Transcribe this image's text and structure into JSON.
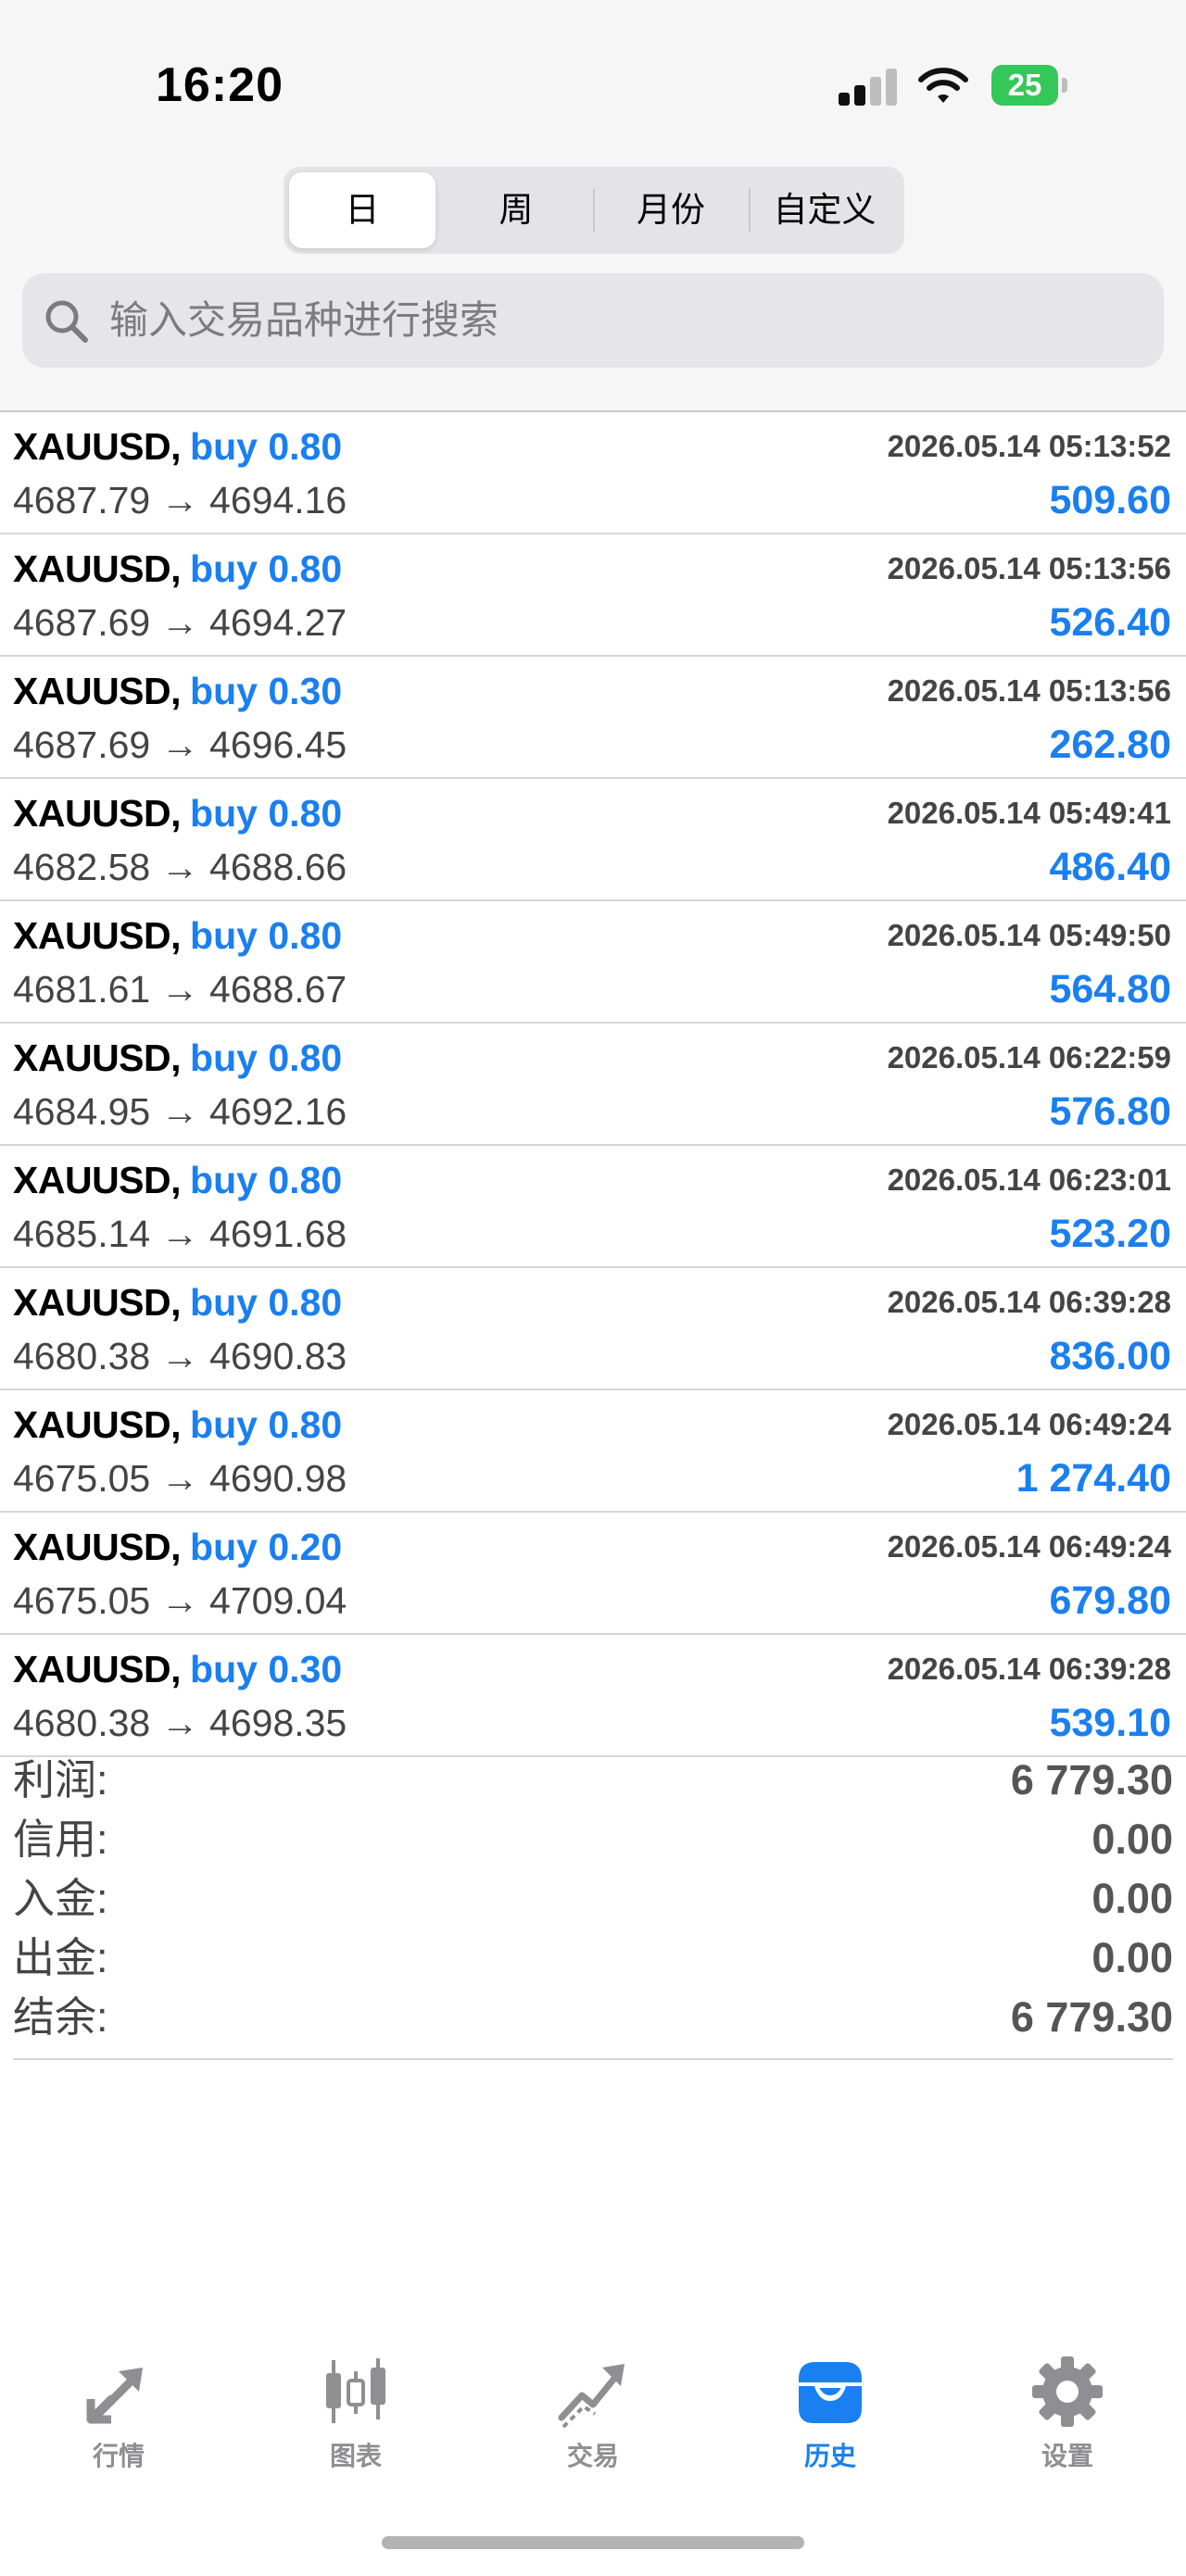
{
  "status_bar": {
    "time": "16:20",
    "battery": "25"
  },
  "segments": {
    "day": "日",
    "week": "周",
    "month": "月份",
    "custom": "自定义",
    "selected": "日"
  },
  "search": {
    "placeholder": "输入交易品种进行搜索"
  },
  "trades": [
    {
      "symbol": "XAUUSD,",
      "side": "buy",
      "volume": "0.80",
      "time": "2026.05.14 05:13:52",
      "open": "4687.79",
      "close": "4694.16",
      "profit": "509.60"
    },
    {
      "symbol": "XAUUSD,",
      "side": "buy",
      "volume": "0.80",
      "time": "2026.05.14 05:13:56",
      "open": "4687.69",
      "close": "4694.27",
      "profit": "526.40"
    },
    {
      "symbol": "XAUUSD,",
      "side": "buy",
      "volume": "0.30",
      "time": "2026.05.14 05:13:56",
      "open": "4687.69",
      "close": "4696.45",
      "profit": "262.80"
    },
    {
      "symbol": "XAUUSD,",
      "side": "buy",
      "volume": "0.80",
      "time": "2026.05.14 05:49:41",
      "open": "4682.58",
      "close": "4688.66",
      "profit": "486.40"
    },
    {
      "symbol": "XAUUSD,",
      "side": "buy",
      "volume": "0.80",
      "time": "2026.05.14 05:49:50",
      "open": "4681.61",
      "close": "4688.67",
      "profit": "564.80"
    },
    {
      "symbol": "XAUUSD,",
      "side": "buy",
      "volume": "0.80",
      "time": "2026.05.14 06:22:59",
      "open": "4684.95",
      "close": "4692.16",
      "profit": "576.80"
    },
    {
      "symbol": "XAUUSD,",
      "side": "buy",
      "volume": "0.80",
      "time": "2026.05.14 06:23:01",
      "open": "4685.14",
      "close": "4691.68",
      "profit": "523.20"
    },
    {
      "symbol": "XAUUSD,",
      "side": "buy",
      "volume": "0.80",
      "time": "2026.05.14 06:39:28",
      "open": "4680.38",
      "close": "4690.83",
      "profit": "836.00"
    },
    {
      "symbol": "XAUUSD,",
      "side": "buy",
      "volume": "0.80",
      "time": "2026.05.14 06:49:24",
      "open": "4675.05",
      "close": "4690.98",
      "profit": "1 274.40"
    },
    {
      "symbol": "XAUUSD,",
      "side": "buy",
      "volume": "0.20",
      "time": "2026.05.14 06:49:24",
      "open": "4675.05",
      "close": "4709.04",
      "profit": "679.80"
    },
    {
      "symbol": "XAUUSD,",
      "side": "buy",
      "volume": "0.30",
      "time": "2026.05.14 06:39:28",
      "open": "4680.38",
      "close": "4698.35",
      "profit": "539.10"
    }
  ],
  "arrow": "→",
  "summary": [
    {
      "label": "利润:",
      "value": "6 779.30"
    },
    {
      "label": "信用:",
      "value": "0.00"
    },
    {
      "label": "入金:",
      "value": "0.00"
    },
    {
      "label": "出金:",
      "value": "0.00"
    },
    {
      "label": "结余:",
      "value": "6 779.30"
    }
  ],
  "tabs": [
    {
      "label": "行情",
      "icon": "quotes-arrows-icon",
      "active": false
    },
    {
      "label": "图表",
      "icon": "candlestick-chart-icon",
      "active": false
    },
    {
      "label": "交易",
      "icon": "trade-trend-icon",
      "active": false
    },
    {
      "label": "历史",
      "icon": "history-inbox-icon",
      "active": true
    },
    {
      "label": "设置",
      "icon": "gear-icon",
      "active": false
    }
  ],
  "colors": {
    "accent": "#1a7ff0",
    "inactive": "#8e8e93",
    "battery": "#34c759"
  }
}
